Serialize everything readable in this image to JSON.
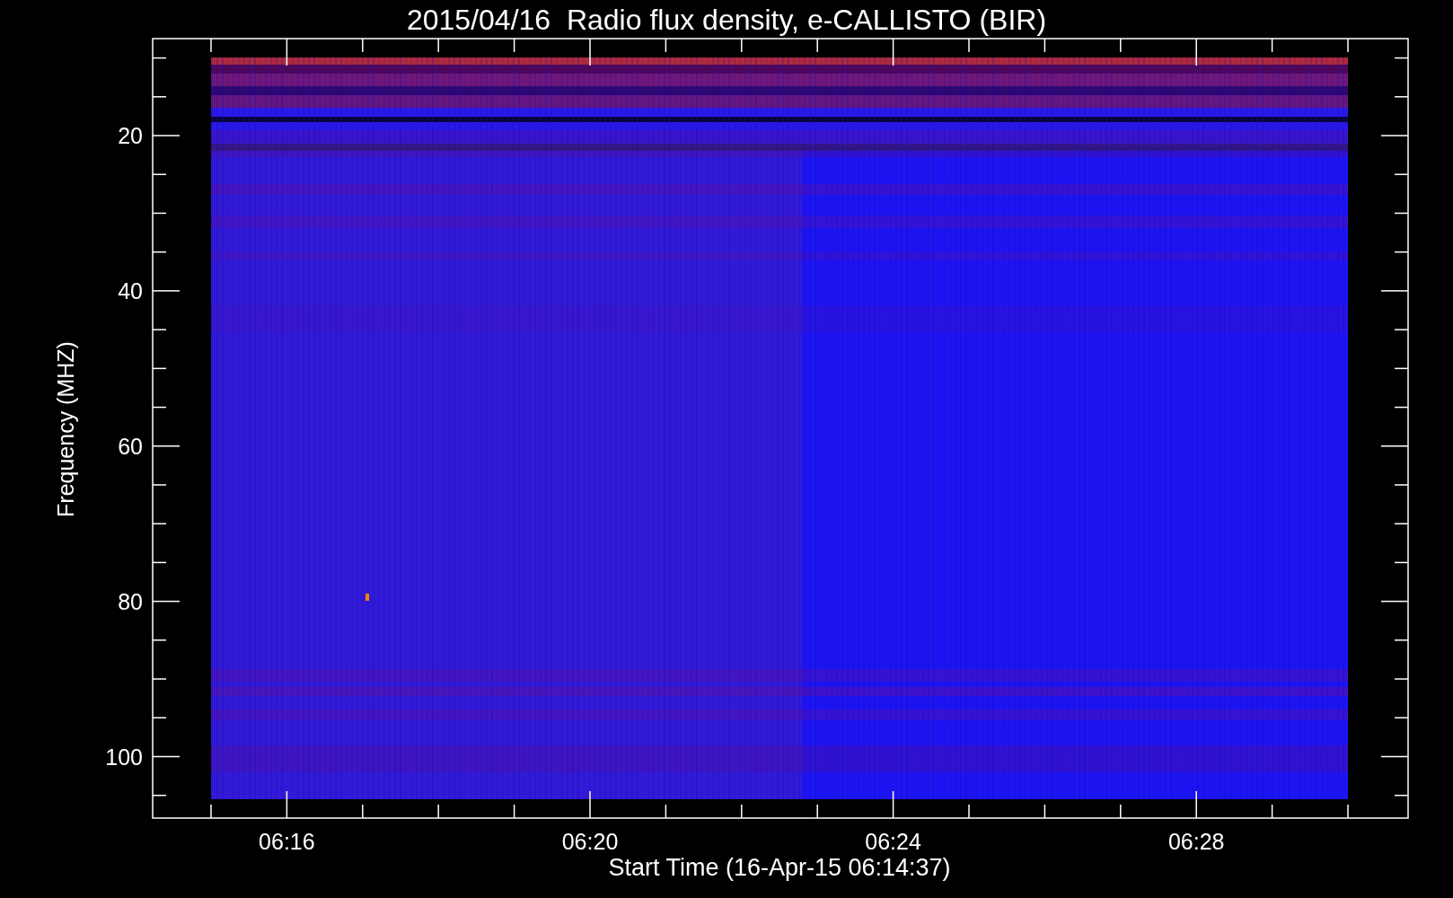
{
  "title": "2015/04/16  Radio flux density, e-CALLISTO (BIR)",
  "y_axis": {
    "label": "Frequency (MHZ)",
    "tick_labels": [
      "20",
      "40",
      "60",
      "80",
      "100"
    ]
  },
  "x_axis": {
    "label": "Start Time (16-Apr-15 06:14:37)",
    "tick_labels": [
      "06:16",
      "06:20",
      "06:24",
      "06:28"
    ]
  }
}
